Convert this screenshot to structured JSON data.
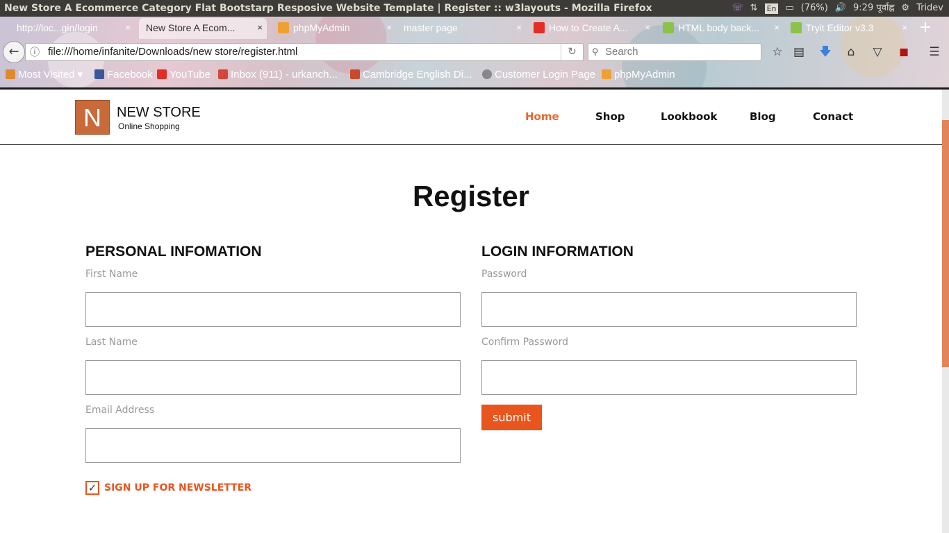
{
  "os": {
    "window_title": "New Store A Ecommerce Category Flat Bootstarp Resposive Website Template | Register :: w3layouts - Mozilla Firefox",
    "tray": {
      "battery": "(76%)",
      "keyboard": "En",
      "clock": "9:29 पूर्वाह्न",
      "user": "Tridev"
    }
  },
  "browser": {
    "tabs": [
      {
        "label": "http://loc...gin/login",
        "icon": "page-icon"
      },
      {
        "label": "New Store A Ecom...",
        "icon": "page-icon"
      },
      {
        "label": "phpMyAdmin",
        "icon": "phpmyadmin-icon"
      },
      {
        "label": "master page",
        "icon": "page-icon"
      },
      {
        "label": "How to Create A...",
        "icon": "youtube-icon"
      },
      {
        "label": "HTML body back...",
        "icon": "w3schools-icon"
      },
      {
        "label": "Tryit Editor v3.3",
        "icon": "w3schools-icon"
      }
    ],
    "close_glyph": "×",
    "new_tab_glyph": "+",
    "url": "file:///home/infanite/Downloads/new store/register.html",
    "search_placeholder": "Search",
    "bookmarks": [
      {
        "label": "Most Visited"
      },
      {
        "label": "Facebook"
      },
      {
        "label": "YouTube"
      },
      {
        "label": "Inbox (911) - urkanch..."
      },
      {
        "label": "Cambridge English Di..."
      },
      {
        "label": "Customer Login Page"
      },
      {
        "label": "phpMyAdmin"
      }
    ]
  },
  "site": {
    "logo_letter": "N",
    "logo_title": "NEW STORE",
    "logo_subtitle": "Online Shopping",
    "nav": [
      {
        "label": "Home",
        "active": true
      },
      {
        "label": "Shop",
        "active": false
      },
      {
        "label": "Lookbook",
        "active": false
      },
      {
        "label": "Blog",
        "active": false
      },
      {
        "label": "Conact",
        "active": false
      }
    ],
    "accent_color": "#e8551e"
  },
  "form": {
    "title": "Register",
    "personal": {
      "heading": "PERSONAL INFOMATION",
      "first_name_label": "First Name",
      "first_name_value": "",
      "last_name_label": "Last Name",
      "last_name_value": "",
      "email_label": "Email Address",
      "email_value": "",
      "newsletter_label": "SIGN UP FOR NEWSLETTER",
      "newsletter_checked": true
    },
    "login": {
      "heading": "LOGIN INFORMATION",
      "password_label": "Password",
      "password_value": "",
      "confirm_label": "Confirm Password",
      "confirm_value": "",
      "submit_label": "submit"
    }
  }
}
